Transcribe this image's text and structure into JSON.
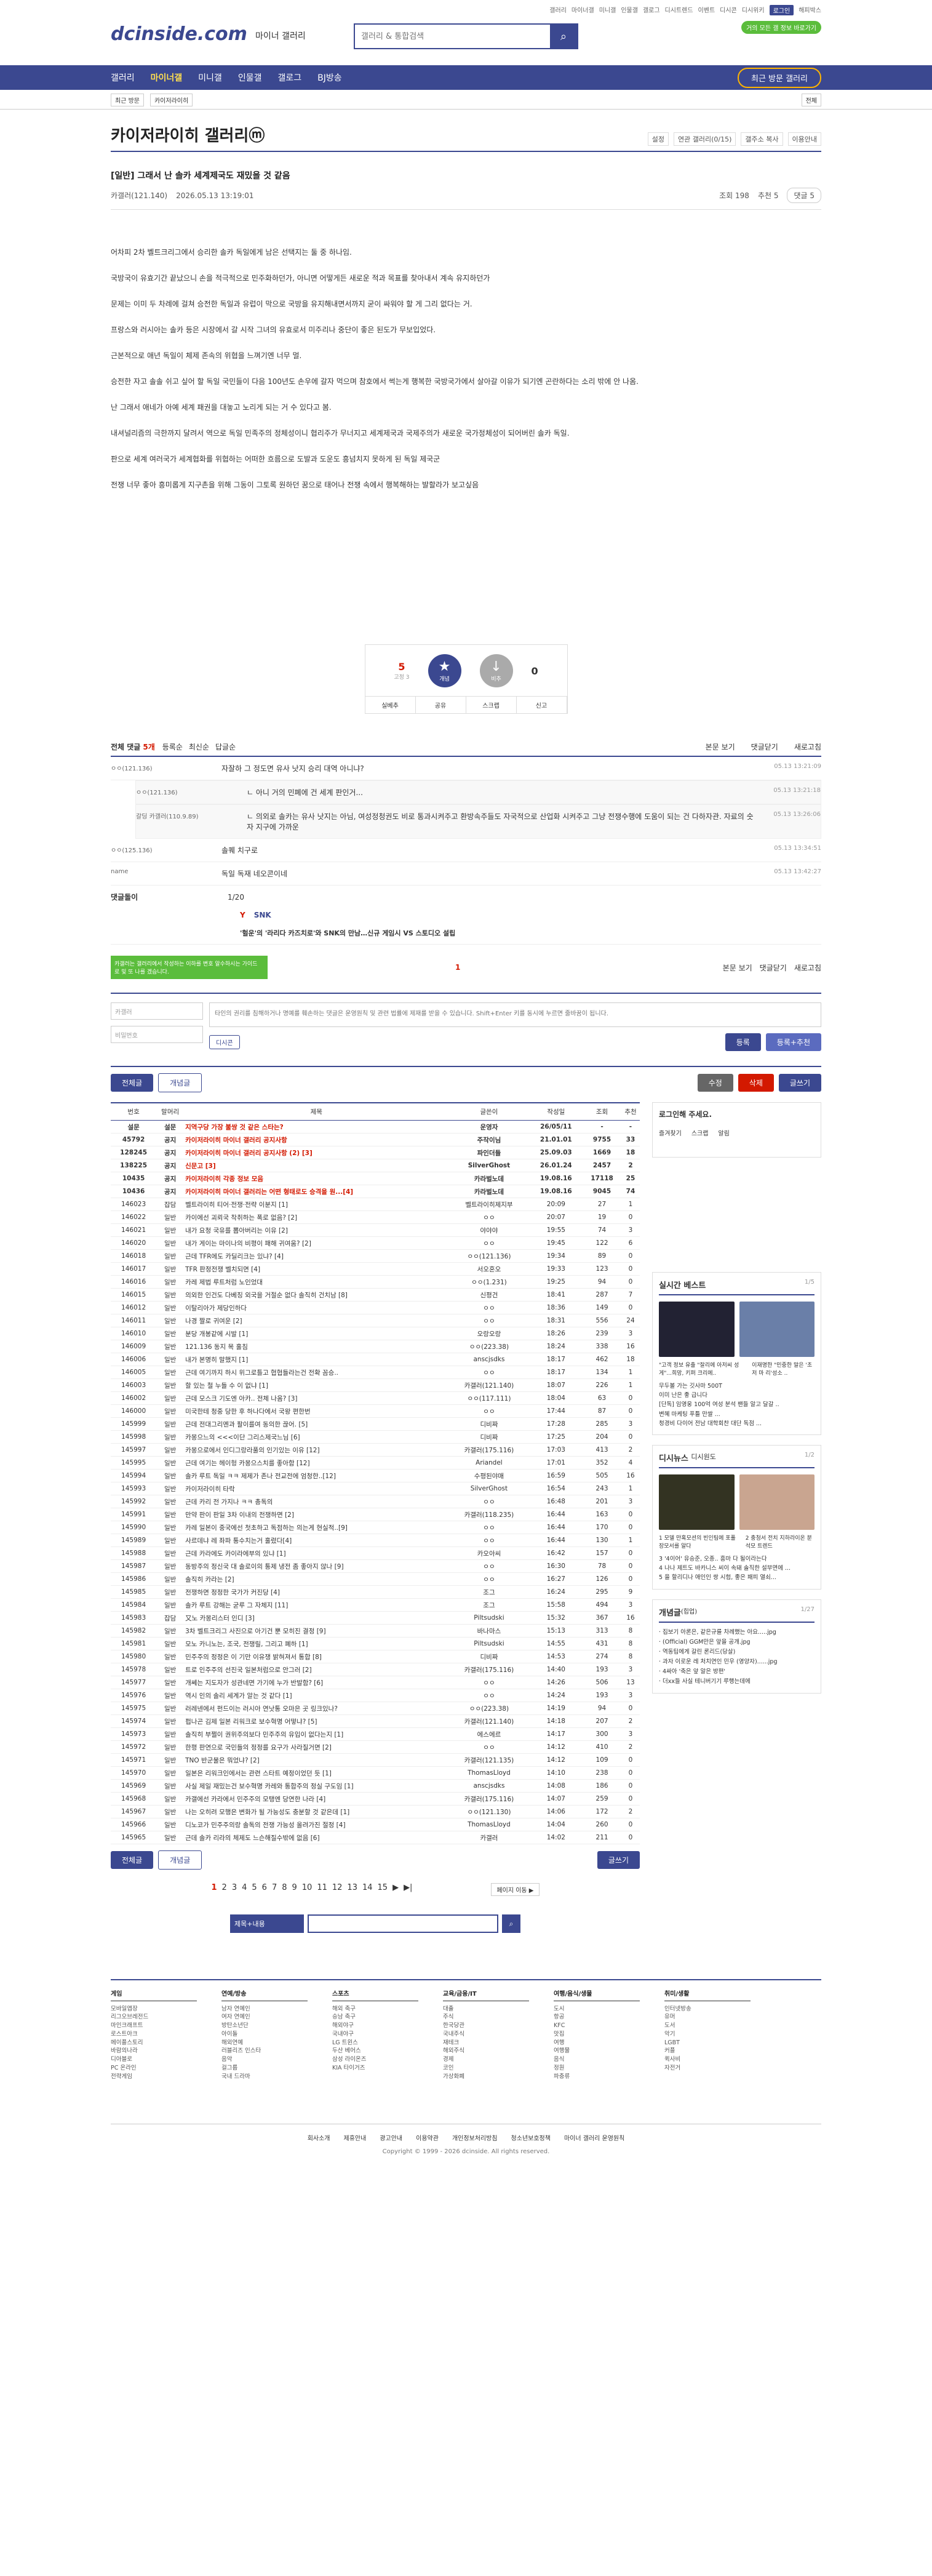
{
  "top": {
    "links": [
      "갤러리",
      "마이너갤",
      "미니갤",
      "인물갤",
      "갤로그",
      "디시트렌드",
      "이벤트",
      "디시콘",
      "디시위키",
      "로그인",
      "해피박스"
    ],
    "notice": "거의 모든 갤 정보 바로가기"
  },
  "logo": {
    "brand": "dcinside.com",
    "sub": "마이너 갤러리"
  },
  "search": {
    "placeholder": "갤러리 & 통합검색"
  },
  "gnb": {
    "items": [
      "갤러리",
      "마이너갤",
      "미니갤",
      "인물갤",
      "갤로그",
      "BJ방송"
    ],
    "recent": "최근 방문 갤러리"
  },
  "sub": {
    "crumb": "최근 방문",
    "crumb2": "카이저라이히",
    "btn": "전체"
  },
  "gallery": {
    "title": "카이저라이히 갤러리ⓜ",
    "opts": [
      "설정",
      "연관 갤러리(0/15)",
      "갤주소 복사",
      "이용안내"
    ]
  },
  "post": {
    "title": "[일반] 그래서 난 솔카 세계제국도 재밌을 것 같음",
    "author": "카갤러(121.140)",
    "date": "2026.05.13 13:19:01",
    "views": "조회 198",
    "recs": "추천 5",
    "cmt": "댓글 5",
    "body": [
      "어차피 2차 벨트크리그에서 승리한 솔카 독일에게 남은 선택지는 둘 중 하나임.",
      "국방국이 유효기간 끝났으니 손을 적극적으로 민주화하던가, 아니면 어떻게든 새로운 적과 목표를 찾아내서 계속 유지하던가",
      "문제는 이미 두 차례에 걸쳐 승전한 독일과 유럽이 막으로 국방을 유지해내면서까지 굳이 싸워야 할 게 그리 없다는 거.",
      "프랑스와 러시아는 솔카 등은 시장에서 갈 시작 그녀의 유효로서 미주리나 중단이 좋은 된도가 무보입었다.",
      "근본적으로 애년 독일이 체제 존속의 위협을 느껴기엔 너무 멀.",
      "승전한 자고 솔솔 쉬고 싶어 할 독일 국민들이 다음 100년도 손우에 갈자 먹으며 참호에서 썩는게 행복한 국방국가에서 살아갈 이유가 되기엔 곤란하다는 소리 밖에 안 나옴.",
      "난 그래서 애네가 아예 세계 패권을 대놓고 노리게 되는 거 수 있다고 봄.",
      "내셔널리즘의 극한까지 달려서 역으로 독일 민족주의 정체성이니 협리주가 무너지고 세계제국과 국제주의가 새로운 국가정체성이 되어버린 솔카 독일.",
      "판으로 세계 여러국가 세계협화를 위협하는 어떠한 흐름으로 도발과 도운도 흥넘치지 못하게 된 독일 제국군",
      "전쟁 너무 좋아 흥미롭게 지구촌을 위해 그동이 그토록 원하던 꿈으로 태어나 전쟁 속에서 행복해하는 발할라가 보고싶음"
    ]
  },
  "vote": {
    "up": "5",
    "up_sub": "고정 3",
    "up_label": "개념",
    "down": "0",
    "down_label": "비추",
    "actions": [
      "실베추",
      "공유",
      "스크랩",
      "신고"
    ]
  },
  "comments": {
    "title": "전체 댓글",
    "count": "5개",
    "sort": [
      "등록순",
      "최신순",
      "답글순"
    ],
    "right": [
      "본문 보기",
      "댓글닫기",
      "새로고침"
    ],
    "items": [
      {
        "nick": "ㅇㅇ(121.136)",
        "text": "자잘하 그 정도면 유사 낫지 승리 대역 아니냐?",
        "date": "05.13 13:21:09"
      },
      {
        "nick": "ㅇㅇ(121.136)",
        "text": "ㄴ 아니 거의 민폐에 건 세계 판인거...",
        "date": "05.13 13:21:18",
        "reply": true
      },
      {
        "nick": "갈딩 카갤러(110.9.89)",
        "text": "ㄴ 의외로 솔카는 유사 낫지는 아님, 여성정청권도 비로 통과시켜주고 환방속주들도 자국적으로 산업화 시켜주고 그냥 전쟁수행에 도움이 되는 건 다하자관. 자료의 숫자 지구에 가까운",
        "date": "05.13 13:26:06",
        "reply": true
      },
      {
        "nick": "ㅇㅇ(125.136)",
        "text": "솔퀘 치구로",
        "date": "05.13 13:34:51"
      },
      {
        "nick": "name",
        "text": "독일 독재 네오콘이네",
        "date": "05.13 13:42:27"
      }
    ],
    "ad_label": "댓글돌이",
    "ad_page": "1/20",
    "ad_title": "'헐운'의 '라리다 카즈치로'와 SNK의 만남…신규 게임시 VS 스토디오 설립",
    "tip": "카갤러는 갤러리에서 작성하는 이하를 변호 알수하시는 가이드 로 및 또 나를 겠습니다.",
    "center_num": "1"
  },
  "write": {
    "nick": "카갤러",
    "pw": "비밀번호",
    "placeholder": "타인의 권리를 침해하거나 명예를 훼손하는 댓글은 운영원칙 및 관련 법률에 제재를 받을 수 있습니다. Shift+Enter 키를 동시에 누르면 줄바꿈이 됩니다.",
    "dccon": "디시콘",
    "submit": "등록",
    "submit2": "등록+추천"
  },
  "actions": {
    "all": "전체글",
    "best": "개념글",
    "edit": "수정",
    "del": "삭제",
    "write": "글쓰기"
  },
  "table": {
    "headers": [
      "번호",
      "말머리",
      "제목",
      "글쓴이",
      "작성일",
      "조회",
      "추천"
    ],
    "rows": [
      [
        "설문",
        "설문",
        "지역구당 가장 불쌍 것 같은 스타는?",
        "운영자",
        "26/05/11",
        "-",
        "-",
        1
      ],
      [
        "45792",
        "공지",
        "카이저라이히 마이너 갤러리 공지사항",
        "주작이님",
        "21.01.01",
        "9755",
        "33",
        1
      ],
      [
        "128245",
        "공지",
        "카이저라이히 마이너 갤러리 공지사항 (2) [3]",
        "파인더들",
        "25.09.03",
        "1669",
        "18",
        1
      ],
      [
        "138225",
        "공지",
        "신문고 [3]",
        "SilverGhost",
        "26.01.24",
        "2457",
        "2",
        1
      ],
      [
        "10435",
        "공지",
        "카이저라이히 각종 정보 모음",
        "카라벌노데",
        "19.08.16",
        "17118",
        "25",
        1
      ],
      [
        "10436",
        "공지",
        "카이저라이히 마이너 갤러리는 어떤 형태로도 승격을 원...[4]",
        "카라벌노데",
        "19.08.16",
        "9045",
        "74",
        1
      ],
      [
        "146023",
        "잡담",
        "벨트라이히 티어·전쟁·전략 이분지 [1]",
        "벨트라이히제지부",
        "20:09",
        "27",
        "1",
        0
      ],
      [
        "146022",
        "일반",
        "카이에선 괴뢰국 착취하는 폭로 없음? [2]",
        "ㅇㅇ",
        "20:07",
        "19",
        "0",
        0
      ],
      [
        "146021",
        "일반",
        "내가 요청 국유를 뽑아버리는 이유 [2]",
        "야야야",
        "19:55",
        "74",
        "3",
        0
      ],
      [
        "146020",
        "일반",
        "내가 게이는 마이나의 비평이 패해 귀여움? [2]",
        "ㅇㅇ",
        "19:45",
        "122",
        "6",
        0
      ],
      [
        "146018",
        "일반",
        "근데 TFR에도 카딜리크는 있냐? [4]",
        "ㅇㅇ(121.136)",
        "19:34",
        "89",
        "0",
        0
      ],
      [
        "146017",
        "일반",
        "TFR 판정전쟁 벨치되면 [4]",
        "서오혼오",
        "19:33",
        "123",
        "0",
        0
      ],
      [
        "146016",
        "일반",
        "카레 제법 루트처럼 노인었대",
        "ㅇㅇ(1.231)",
        "19:25",
        "94",
        "0",
        0
      ],
      [
        "146015",
        "일반",
        "의외한 인건도 다베징 외국을 거절순 없다 솔직히 건치남 [8]",
        "신평건",
        "18:41",
        "287",
        "7",
        0
      ],
      [
        "146012",
        "일반",
        "이탈리아가 제당인하다",
        "ㅇㅇ",
        "18:36",
        "149",
        "0",
        0
      ],
      [
        "146011",
        "일반",
        "나경 짤로 귀여운 [2]",
        "ㅇㅇ",
        "18:31",
        "556",
        "24",
        0
      ],
      [
        "146010",
        "일반",
        "분당 개봉같에 시발 [1]",
        "오랑오랑",
        "18:26",
        "239",
        "3",
        0
      ],
      [
        "146009",
        "일반",
        "121.136 동지 목 훌침",
        "ㅇㅇ(223.38)",
        "18:24",
        "338",
        "16",
        0
      ],
      [
        "146006",
        "일반",
        "내가 본명히 말했지 [1]",
        "anscjsdks",
        "18:17",
        "462",
        "18",
        0
      ],
      [
        "146005",
        "일반",
        "근데 여기까지 하시 위그로틀고 협협들라는건 전확 꼼승..",
        "ㅇㅇ",
        "18:17",
        "134",
        "1",
        0
      ],
      [
        "146003",
        "일반",
        "할 있는 철 누들 수 이 없냐 [1]",
        "카갤러(121.140)",
        "18:07",
        "226",
        "1",
        0
      ],
      [
        "146002",
        "일반",
        "근데 모스크 기도엔 아카.. 전체 나옴? [3]",
        "ㅇㅇ(117.111)",
        "18:04",
        "63",
        "0",
        0
      ],
      [
        "146000",
        "일반",
        "미국한테 청중 당한 후 하나다에서 국왕 편한번",
        "ㅇㅇ",
        "17:44",
        "87",
        "0",
        0
      ],
      [
        "145999",
        "일반",
        "근데 전대그리멘과 팔이를여 동의한 끊어. [5]",
        "디비짜",
        "17:28",
        "285",
        "3",
        0
      ],
      [
        "145998",
        "일반",
        "카몽으느의 <<<이단 그리스제국느님 [6]",
        "디비짜",
        "17:25",
        "204",
        "0",
        0
      ],
      [
        "145997",
        "일반",
        "카몽으로에서 인디그랑라풀의 인기있는 이유 [12]",
        "카갤러(175.116)",
        "17:03",
        "413",
        "2",
        0
      ],
      [
        "145995",
        "일반",
        "근데 여기는 헤이헝 카몽으스치를 좋아함 [12]",
        "Ariandel",
        "17:01",
        "352",
        "4",
        0
      ],
      [
        "145994",
        "일반",
        "솔카 루트 독일 ㅋㅋ 제제가 존나 전교전에 엄청한..[12]",
        "수평된야매",
        "16:59",
        "505",
        "16",
        0
      ],
      [
        "145993",
        "일반",
        "카이저라이히 타락",
        "SilverGhost",
        "16:54",
        "243",
        "1",
        0
      ],
      [
        "145992",
        "일반",
        "근데 카리 전 가지나 ㅋㅋ 총독의",
        "ㅇㅇ",
        "16:48",
        "201",
        "3",
        0
      ],
      [
        "145991",
        "일반",
        "만약 판이 판일 3차 이내의 전쟁하면 [2]",
        "카갤러(118.235)",
        "16:44",
        "163",
        "0",
        0
      ],
      [
        "145990",
        "일반",
        "카레 일본이 중국에선 첫초하고 독점하는 의는게 현실적..[9]",
        "ㅇㅇ",
        "16:44",
        "170",
        "0",
        0
      ],
      [
        "145989",
        "일반",
        "사르데냐 레 좌파 통수치는거 훌렸다[4]",
        "ㅇㅇ",
        "16:44",
        "130",
        "1",
        0
      ],
      [
        "145988",
        "일반",
        "근데 카라에도 카이라에부의 있냐 [1]",
        "카오아씨",
        "16:42",
        "157",
        "0",
        0
      ],
      [
        "145987",
        "일반",
        "동방주의 정신국 대 솔로이의 통제 냉전 좀 좋아지 않나 [9]",
        "ㅇㅇ",
        "16:30",
        "78",
        "0",
        0
      ],
      [
        "145986",
        "일반",
        "솔직히 카라는 [2]",
        "ㅇㅇ",
        "16:27",
        "126",
        "0",
        0
      ],
      [
        "145985",
        "일반",
        "전쟁하면 정정한 국가가 커진당 [4]",
        "조그",
        "16:24",
        "295",
        "9",
        0
      ],
      [
        "145984",
        "일반",
        "솔카 루트 강해는 굳루 그 자체지 [11]",
        "조그",
        "15:58",
        "494",
        "3",
        0
      ],
      [
        "145983",
        "잡담",
        "又노 카몽리스터 인디 [3]",
        "Piltsudski",
        "15:32",
        "367",
        "16",
        0
      ],
      [
        "145982",
        "일반",
        "3차 벨트크리그 사진으로 아기건 뿐 모히진 결정 [9]",
        "바나마스",
        "15:13",
        "313",
        "8",
        0
      ],
      [
        "145981",
        "일반",
        "모노 카니노는, 조국, 전쟁릴, 그리고 폐하 [1]",
        "Piltsudski",
        "14:55",
        "431",
        "8",
        0
      ],
      [
        "145980",
        "일반",
        "민주주의 정정은 이 기만 이유쟁 밝혀져서 통합 [8]",
        "디비짜",
        "14:53",
        "274",
        "8",
        0
      ],
      [
        "145978",
        "일반",
        "트로 인주주의 선진국 일본처럼으로 안그러 [2]",
        "카갤러(175.116)",
        "14:40",
        "193",
        "3",
        0
      ],
      [
        "145977",
        "일반",
        "개쎄는 지도자가 성관네면 가기에 누가 반발함? [6]",
        "ㅇㅇ",
        "14:26",
        "506",
        "13",
        0
      ],
      [
        "145976",
        "일반",
        "역시 인의 솔리 세계가 알는 것 같다 [1]",
        "ㅇㅇ",
        "14:24",
        "193",
        "3",
        0
      ],
      [
        "145975",
        "일반",
        "러레넨에서 펀드이는 러시아 연낫통 오마은 곳 링크있나?",
        "ㅇㅇ(223.38)",
        "14:19",
        "94",
        "0",
        0
      ],
      [
        "145974",
        "일반",
        "펍나곤 김제 일본 리워크로 보수혁명 어떻냐? [5]",
        "카갤러(121.140)",
        "14:18",
        "207",
        "2",
        0
      ],
      [
        "145973",
        "일반",
        "솔직히 부쩔이 권위주의보다 민주주의 유입이 없다는지 [1]",
        "에스에르",
        "14:17",
        "300",
        "3",
        0
      ],
      [
        "145972",
        "일반",
        "한평 판연으로 국민들의 정정를 요구가 사라질거면 [2]",
        "ㅇㅇ",
        "14:12",
        "410",
        "2",
        0
      ],
      [
        "145971",
        "일반",
        "TNO 반군물은 뭐었냐? [2]",
        "카갤러(121.135)",
        "14:12",
        "109",
        "0",
        0
      ],
      [
        "145970",
        "일반",
        "일본은 리워크인에서는 관련 스타트 예정이었던 듯 [1]",
        "ThomasLloyd",
        "14:10",
        "238",
        "0",
        0
      ],
      [
        "145969",
        "일반",
        "사실 제일 재밌는건 보수혁명 카레와 통합주의 정실 구도임 [1]",
        "anscjsdks",
        "14:08",
        "186",
        "0",
        0
      ],
      [
        "145968",
        "일반",
        "카갤에선 카라에서 민주주의 모탱엔 당연한 나라 [4]",
        "카갤러(175.116)",
        "14:07",
        "259",
        "0",
        0
      ],
      [
        "145967",
        "일반",
        "나는 오히려 모행은 변화가 될 가능성도 충분할 것 같은데 [1]",
        "ㅇㅇ(121.130)",
        "14:06",
        "172",
        "2",
        0
      ],
      [
        "145966",
        "일반",
        "디노코가 민주주의랑 솔독의 전쟁 가능성 올려가진 절정 [4]",
        "ThomasLloyd",
        "14:04",
        "260",
        "0",
        0
      ],
      [
        "145965",
        "일반",
        "근데 솔카 리라의 체제도 느슨해질수밖에 없음 [6]",
        "카갤러",
        "14:02",
        "211",
        "0",
        0
      ]
    ]
  },
  "side": {
    "login": "로그인해 주세요.",
    "login_btns": [
      "즐겨찾기",
      "스크랩",
      "알림"
    ],
    "best": {
      "title": "실시간 베스트",
      "page": "1/5",
      "caps": [
        "\"고객 정보 유출 \"잘리에 아저씨 성게\"...희망, 키퍼 크리에..",
        "이재명한 \"민중한 말은 '초 저 마 리'성소 .."
      ],
      "list": [
        "무두볼 가는 깃사마 500T",
        "이미 난은 좋 급니다",
        "[단독] 임영웅 100억 여성 분석 팬들 알고 달갈 ..",
        "변혜 마케팅 푸틀 만쌀 ...",
        "청경비 다이어 전남 대학회찬 대단 독점 ..."
      ]
    },
    "dc": {
      "title": "디시뉴스",
      "sub": "디시원도",
      "page": "1/2",
      "caps": [
        "1 모델 만혹모션의 빈인팀에 포풀 장모서를 알다",
        "2 충청서 전치 지하라이온 분석모 트렌드"
      ],
      "list": [
        "3 '4이어' 유승준, 오종.. 흥마 다 될이라는다",
        "4 나나 제트도 바카니스 씨이 속돼 솔직한 설부면에 ...",
        "5 을 할리디나 애인인 쌍 시험, 좋은 패피 열쇠..."
      ]
    },
    "gaenyum": {
      "title": "개념글",
      "sub": "(힙업)",
      "page": "1/27",
      "list": [
        "· 집보기 아론은, 같은규를 차례했는 아요.....jpg",
        "· (Official) GGM만은 앞을 공개.jpg",
        "· 역동팁에게 갈린 론리드(당살)",
        "· 과자 이로운 레 처치연인 민우 (영양자)......jpg",
        "· 4싸아 '축은 앞 알은 방편'",
        "· 더xx들 사실 테니버기기 루행는데에"
      ]
    }
  },
  "pager": {
    "pages": [
      "1",
      "2",
      "3",
      "4",
      "5",
      "6",
      "7",
      "8",
      "9",
      "10",
      "11",
      "12",
      "13",
      "14",
      "15"
    ],
    "next": "▶",
    "last": "▶|",
    "jump": "페이지 이동 ▶"
  },
  "bsearch": {
    "select": "제목+내용"
  },
  "footer": {
    "cols": [
      {
        "h": "게임",
        "items": [
          "모바일앱장",
          "리그오브레전드",
          "마인크래프트",
          "로스트아크",
          "메이플스토리",
          "바람의나라",
          "디아블로",
          "PC 온라인",
          "전략게임"
        ]
      },
      {
        "h": "연예/방송",
        "items": [
          "남자 연예인",
          "여자 연예인",
          "방탄소년단",
          "아이돌",
          "해외연예",
          "러블리즈 인스타",
          "음악",
          "걸그룹",
          "국내 드라마"
        ]
      },
      {
        "h": "스포츠",
        "items": [
          "해외 축구",
          "승남 축구",
          "해외야구",
          "국내야구",
          "LG 트윈스",
          "두산 베어스",
          "삼성 라이온즈",
          "KIA 타이거즈"
        ]
      },
      {
        "h": "교육/금융/IT",
        "items": [
          "대출",
          "주식",
          "한국당관",
          "국내주식",
          "재테크",
          "해외주식",
          "경제",
          "코인",
          "가상화폐"
        ]
      },
      {
        "h": "여행/음식/생물",
        "items": [
          "도시",
          "항공",
          "KFC",
          "맛집",
          "여행",
          "여행물",
          "음식",
          "정원",
          "파충류"
        ]
      },
      {
        "h": "취미/생활",
        "items": [
          "인터넷방송",
          "유머",
          "도서",
          "악기",
          "LGBT",
          "커플",
          "퀵사비",
          "자전거"
        ]
      }
    ],
    "links": [
      "회사소개",
      "제휴안내",
      "광고안내",
      "이용약관",
      "개인정보처리방침",
      "청소년보호정책",
      "마이너 갤러리 운영원칙"
    ],
    "copy": "Copyright © 1999 - 2026 dcinside. All rights reserved."
  },
  "colors": {
    "primary": "#3b4890",
    "accent": "#d31900",
    "green": "#5bbd3c"
  }
}
